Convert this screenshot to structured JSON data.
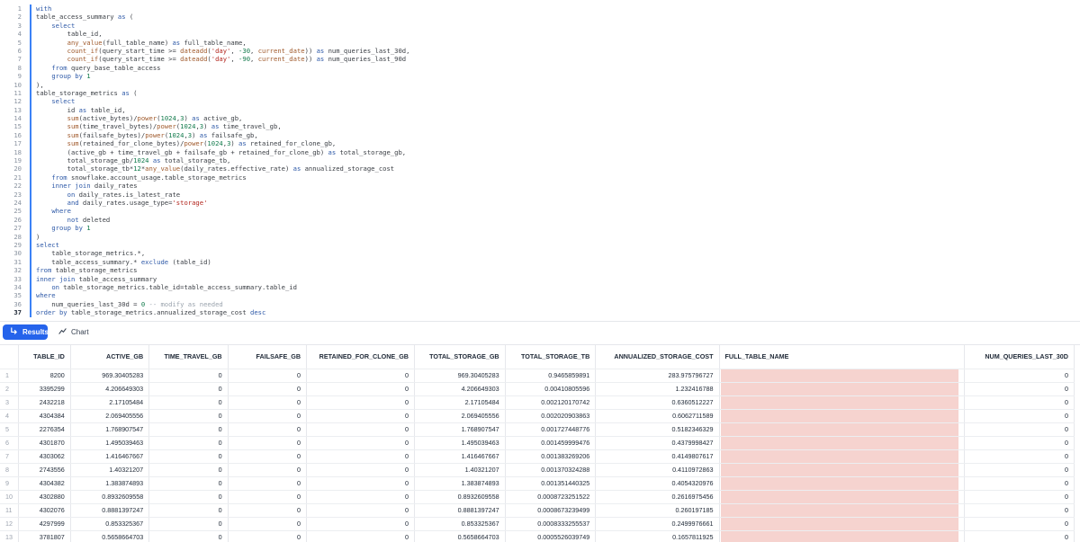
{
  "editor": {
    "active_line": 37,
    "line_numbers": [
      "1",
      "2",
      "3",
      "4",
      "5",
      "6",
      "7",
      "8",
      "9",
      "10",
      "11",
      "12",
      "13",
      "14",
      "15",
      "16",
      "17",
      "18",
      "19",
      "20",
      "21",
      "22",
      "23",
      "24",
      "25",
      "26",
      "27",
      "28",
      "29",
      "30",
      "31",
      "32",
      "33",
      "34",
      "35",
      "36",
      "37"
    ],
    "lines": [
      "with",
      "table_access_summary as (",
      "    select",
      "        table_id,",
      "        any_value(full_table_name) as full_table_name,",
      "        count_if(query_start_time >= dateadd('day', -30, current_date)) as num_queries_last_30d,",
      "        count_if(query_start_time >= dateadd('day', -90, current_date)) as num_queries_last_90d",
      "    from query_base_table_access",
      "    group by 1",
      "),",
      "table_storage_metrics as (",
      "    select",
      "        id as table_id,",
      "        sum(active_bytes)/power(1024,3) as active_gb,",
      "        sum(time_travel_bytes)/power(1024,3) as time_travel_gb,",
      "        sum(failsafe_bytes)/power(1024,3) as failsafe_gb,",
      "        sum(retained_for_clone_bytes)/power(1024,3) as retained_for_clone_gb,",
      "        (active_gb + time_travel_gb + failsafe_gb + retained_for_clone_gb) as total_storage_gb,",
      "        total_storage_gb/1024 as total_storage_tb,",
      "        total_storage_tb*12*any_value(daily_rates.effective_rate) as annualized_storage_cost",
      "    from snowflake.account_usage.table_storage_metrics",
      "    inner join daily_rates",
      "        on daily_rates.is_latest_rate",
      "        and daily_rates.usage_type='storage'",
      "    where",
      "        not deleted",
      "    group by 1",
      ")",
      "select",
      "    table_storage_metrics.*,",
      "    table_access_summary.* exclude (table_id)",
      "from table_storage_metrics",
      "inner join table_access_summary",
      "    on table_storage_metrics.table_id=table_access_summary.table_id",
      "where",
      "    num_queries_last_30d = 0 -- modify as needed",
      "order by table_storage_metrics.annualized_storage_cost desc"
    ]
  },
  "tabs": {
    "results_label": "Results",
    "results_icon": "return-arrow-icon",
    "chart_label": "Chart",
    "chart_icon": "line-chart-icon"
  },
  "grid": {
    "columns": [
      "",
      "TABLE_ID",
      "ACTIVE_GB",
      "TIME_TRAVEL_GB",
      "FAILSAFE_GB",
      "RETAINED_FOR_CLONE_GB",
      "TOTAL_STORAGE_GB",
      "TOTAL_STORAGE_TB",
      "ANNUALIZED_STORAGE_COST",
      "FULL_TABLE_NAME",
      "NUM_QUERIES_LAST_30D"
    ],
    "redaction_color": "#f6d3cf",
    "rows": [
      [
        "1",
        "8200",
        "969.30405283",
        "0",
        "0",
        "0",
        "969.30405283",
        "0.9465859891",
        "283.975796727",
        "",
        "0"
      ],
      [
        "2",
        "3395299",
        "4.206649303",
        "0",
        "0",
        "0",
        "4.206649303",
        "0.00410805596",
        "1.232416788",
        "",
        "0"
      ],
      [
        "3",
        "2432218",
        "2.17105484",
        "0",
        "0",
        "0",
        "2.17105484",
        "0.002120170742",
        "0.6360512227",
        "",
        "0"
      ],
      [
        "4",
        "4304384",
        "2.069405556",
        "0",
        "0",
        "0",
        "2.069405556",
        "0.002020903863",
        "0.6062711589",
        "",
        "0"
      ],
      [
        "5",
        "2276354",
        "1.768907547",
        "0",
        "0",
        "0",
        "1.768907547",
        "0.001727448776",
        "0.5182346329",
        "",
        "0"
      ],
      [
        "6",
        "4301870",
        "1.495039463",
        "0",
        "0",
        "0",
        "1.495039463",
        "0.001459999476",
        "0.4379998427",
        "",
        "0"
      ],
      [
        "7",
        "4303062",
        "1.416467667",
        "0",
        "0",
        "0",
        "1.416467667",
        "0.001383269206",
        "0.4149807617",
        "",
        "0"
      ],
      [
        "8",
        "2743556",
        "1.40321207",
        "0",
        "0",
        "0",
        "1.40321207",
        "0.001370324288",
        "0.4110972863",
        "",
        "0"
      ],
      [
        "9",
        "4304382",
        "1.383874893",
        "0",
        "0",
        "0",
        "1.383874893",
        "0.001351440325",
        "0.4054320976",
        "",
        "0"
      ],
      [
        "10",
        "4302880",
        "0.8932609558",
        "0",
        "0",
        "0",
        "0.8932609558",
        "0.0008723251522",
        "0.2616975456",
        "",
        "0"
      ],
      [
        "11",
        "4302076",
        "0.8881397247",
        "0",
        "0",
        "0",
        "0.8881397247",
        "0.0008673239499",
        "0.260197185",
        "",
        "0"
      ],
      [
        "12",
        "4297999",
        "0.853325367",
        "0",
        "0",
        "0",
        "0.853325367",
        "0.0008333255537",
        "0.2499976661",
        "",
        "0"
      ],
      [
        "13",
        "3781807",
        "0.5658664703",
        "0",
        "0",
        "0",
        "0.5658664703",
        "0.0005526039749",
        "0.1657811925",
        "",
        "0"
      ]
    ]
  }
}
